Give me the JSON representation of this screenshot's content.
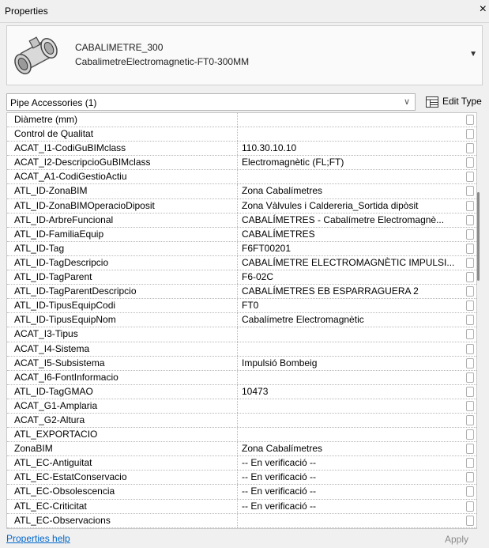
{
  "window": {
    "title": "Properties",
    "close_glyph": "×"
  },
  "type_selector": {
    "name": "CABALIMETRE_300",
    "subtype": "CabalimetreElectromagnetic-FT0-300MM",
    "dropdown_icon": "chevron-down-icon"
  },
  "filter": {
    "selected": "Pipe Accessories (1)",
    "edit_type_label": "Edit Type"
  },
  "properties": [
    {
      "name": "Diàmetre (mm)",
      "value": ""
    },
    {
      "name": "Control de Qualitat",
      "value": ""
    },
    {
      "name": "ACAT_I1-CodiGuBIMclass",
      "value": "110.30.10.10"
    },
    {
      "name": "ACAT_I2-DescripcioGuBIMclass",
      "value": "Electromagnètic (FL;FT)"
    },
    {
      "name": "ACAT_A1-CodiGestioActiu",
      "value": ""
    },
    {
      "name": "ATL_ID-ZonaBIM",
      "value": "Zona Cabalímetres"
    },
    {
      "name": "ATL_ID-ZonaBIMOperacioDiposit",
      "value": "Zona Vàlvules i Caldereria_Sortida dipòsit"
    },
    {
      "name": "ATL_ID-ArbreFuncional",
      "value": "CABALÍMETRES - Cabalímetre Electromagnè..."
    },
    {
      "name": "ATL_ID-FamiliaEquip",
      "value": "CABALÍMETRES"
    },
    {
      "name": "ATL_ID-Tag",
      "value": "F6FT00201"
    },
    {
      "name": "ATL_ID-TagDescripcio",
      "value": "CABALÍMETRE ELECTROMAGNÈTIC IMPULSI..."
    },
    {
      "name": "ATL_ID-TagParent",
      "value": "F6-02C"
    },
    {
      "name": "ATL_ID-TagParentDescripcio",
      "value": "CABALÍMETRES EB ESPARRAGUERA 2"
    },
    {
      "name": "ATL_ID-TipusEquipCodi",
      "value": "FT0"
    },
    {
      "name": "ATL_ID-TipusEquipNom",
      "value": "Cabalímetre Electromagnètic"
    },
    {
      "name": "ACAT_I3-Tipus",
      "value": ""
    },
    {
      "name": "ACAT_I4-Sistema",
      "value": ""
    },
    {
      "name": "ACAT_I5-Subsistema",
      "value": "Impulsió Bombeig"
    },
    {
      "name": "ACAT_I6-FontInformacio",
      "value": ""
    },
    {
      "name": "ATL_ID-TagGMAO",
      "value": "10473"
    },
    {
      "name": "ACAT_G1-Amplaria",
      "value": ""
    },
    {
      "name": "ACAT_G2-Altura",
      "value": ""
    },
    {
      "name": "ATL_EXPORTACIO",
      "value": ""
    },
    {
      "name": "ZonaBIM",
      "value": "Zona Cabalímetres"
    },
    {
      "name": "ATL_EC-Antiguitat",
      "value": "-- En verificació --"
    },
    {
      "name": "ATL_EC-EstatConservacio",
      "value": "-- En verificació --"
    },
    {
      "name": "ATL_EC-Obsolescencia",
      "value": "-- En verificació --"
    },
    {
      "name": "ATL_EC-Criticitat",
      "value": "-- En verificació --"
    },
    {
      "name": "ATL_EC-Observacions",
      "value": ""
    }
  ],
  "footer": {
    "help_link": "Properties help",
    "apply_label": "Apply"
  }
}
